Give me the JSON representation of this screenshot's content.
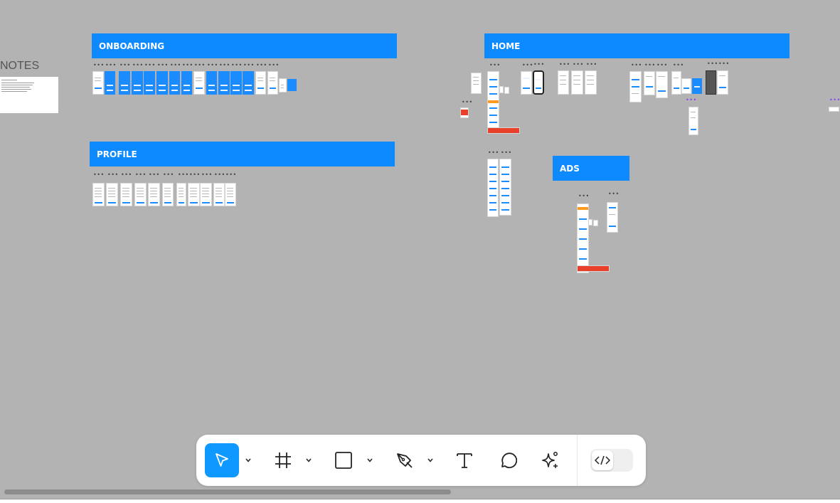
{
  "canvas": {
    "notes_title": "NOTES",
    "sections": {
      "onboarding": "ONBOARDING",
      "home": "HOME",
      "profile": "PROFILE",
      "ads": "ADS"
    },
    "frame_menu_glyph": "•••"
  },
  "toolbar": {
    "tools": [
      {
        "name": "Move",
        "icon": "cursor-arrow-icon",
        "active": true
      },
      {
        "name": "Frame",
        "icon": "hash-frame-icon"
      },
      {
        "name": "Rectangle",
        "icon": "square-icon"
      },
      {
        "name": "Pen",
        "icon": "pen-nib-icon"
      },
      {
        "name": "Text",
        "icon": "text-t-icon"
      },
      {
        "name": "Comment",
        "icon": "speech-bubble-icon"
      },
      {
        "name": "Actions",
        "icon": "sparkle-icon"
      }
    ],
    "dev_mode_icon": "code-brackets-icon"
  },
  "colors": {
    "canvas_bg": "#b3b3b3",
    "section_header": "#0d8aff",
    "accent": "#0d99ff",
    "dots_purple": "#8a3df2"
  }
}
